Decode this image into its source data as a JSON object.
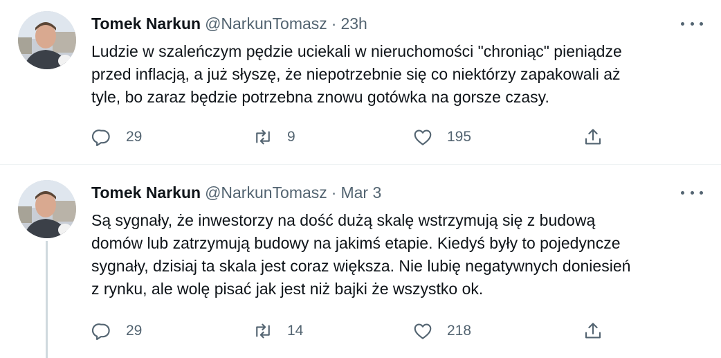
{
  "colors": {
    "text_primary": "#0f1419",
    "text_secondary": "#536471",
    "divider": "#eff3f4",
    "thread_line": "#cfd9de"
  },
  "icons": {
    "reply": "speech-bubble-icon",
    "retweet": "retweet-arrows-icon",
    "like": "heart-icon",
    "share": "share-upload-icon",
    "more": "more-dots-icon"
  },
  "tweets": [
    {
      "author_name": "Tomek Narkun",
      "author_handle": "@NarkunTomasz",
      "separator": "·",
      "time": "23h",
      "text": "Ludzie w szaleńczym pędzie uciekali w nieruchomości \"chroniąc\" pieniądze\nprzed inflacją, a już słyszę, że niepotrzebnie się co niektórzy zapakowali aż\ntyle, bo zaraz będzie potrzebna znowu gotówka na gorsze czasy.",
      "replies": "29",
      "retweets": "9",
      "likes": "195"
    },
    {
      "author_name": "Tomek Narkun",
      "author_handle": "@NarkunTomasz",
      "separator": "·",
      "time": "Mar 3",
      "text": "Są sygnały, że inwestorzy na dość dużą skalę wstrzymują się z budową\ndomów lub zatrzymują budowy na jakimś etapie. Kiedyś były to pojedyncze\nsygnały, dzisiaj ta skala jest coraz większa. Nie lubię negatywnych doniesień\nz rynku, ale wolę pisać jak jest niż bajki że wszystko ok.",
      "replies": "29",
      "retweets": "14",
      "likes": "218"
    }
  ]
}
